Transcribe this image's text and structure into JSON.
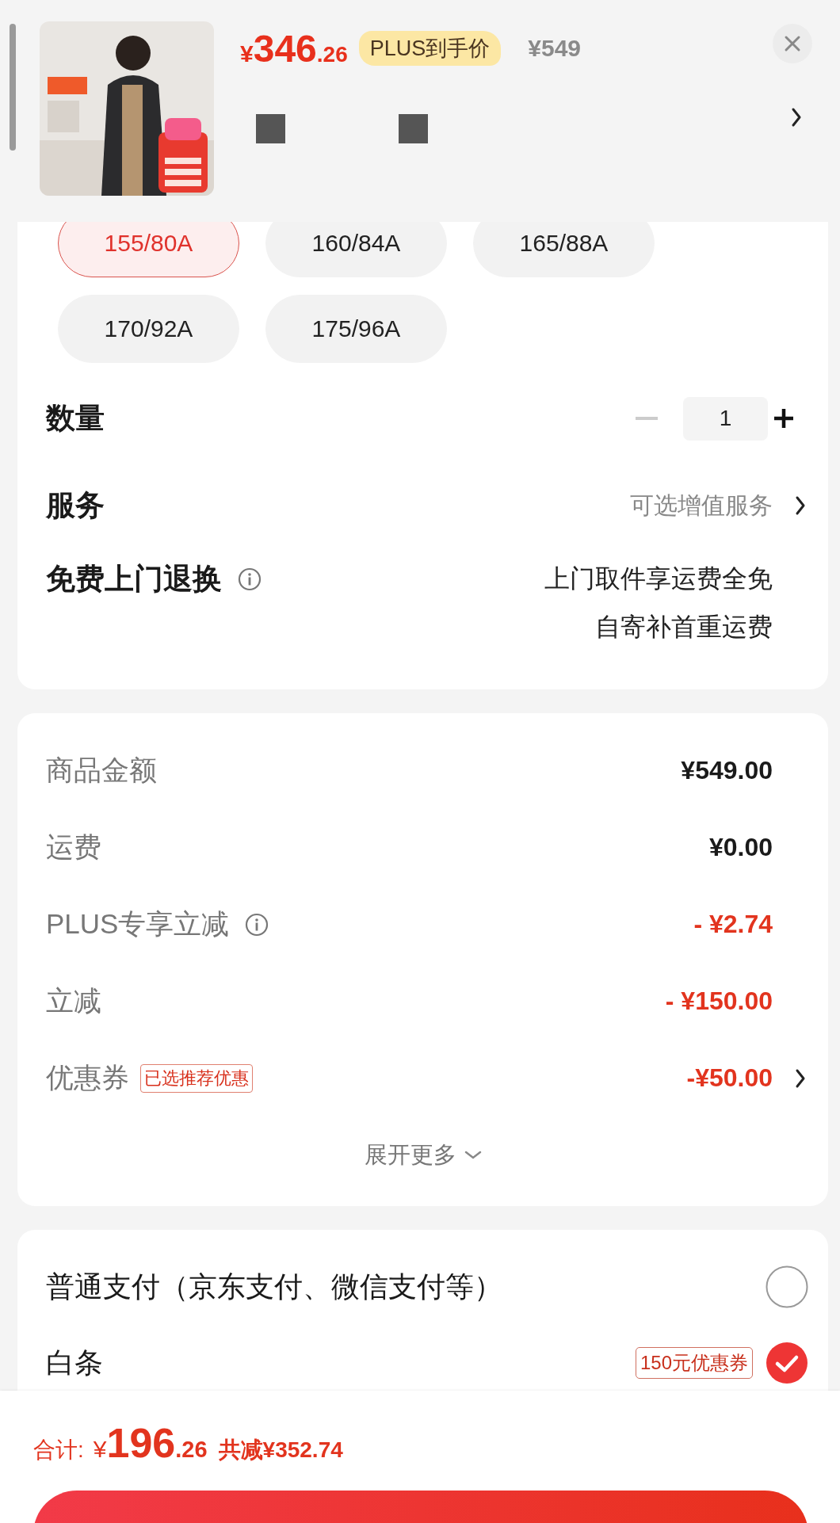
{
  "header": {
    "price_symbol": "¥",
    "price_integer": "346",
    "price_decimal": ".26",
    "plus_badge": "PLUS到手价",
    "original_price": "¥549"
  },
  "sizes": [
    {
      "label": "155/80A",
      "selected": true
    },
    {
      "label": "160/84A",
      "selected": false
    },
    {
      "label": "165/88A",
      "selected": false
    },
    {
      "label": "170/92A",
      "selected": false
    },
    {
      "label": "175/96A",
      "selected": false
    }
  ],
  "quantity": {
    "label": "数量",
    "value": "1",
    "minus_disabled": true
  },
  "service": {
    "label": "服务",
    "value": "可选增值服务"
  },
  "return_policy": {
    "label": "免费上门退换",
    "lines": [
      "上门取件享运费全免",
      "自寄补首重运费"
    ]
  },
  "price_rows": [
    {
      "label": "商品金额",
      "value": "¥549.00",
      "kind": "normal"
    },
    {
      "label": "运费",
      "value": "¥0.00",
      "kind": "normal"
    },
    {
      "label": "PLUS专享立减",
      "value": "- ¥2.74",
      "kind": "discount",
      "info": true
    },
    {
      "label": "立减",
      "value": "- ¥150.00",
      "kind": "discount"
    },
    {
      "label": "优惠券",
      "tag": "已选推荐优惠",
      "value": "-¥50.00",
      "kind": "discount",
      "link": true
    }
  ],
  "expand": "展开更多",
  "payments": [
    {
      "label": "普通支付（京东支付、微信支付等）",
      "selected": false
    },
    {
      "label": "白条",
      "tag": "150元优惠券",
      "selected": true
    }
  ],
  "total": {
    "label": "合计:",
    "symbol": "¥",
    "integer": "196",
    "decimal": ".26",
    "saving": "共减¥352.74"
  }
}
